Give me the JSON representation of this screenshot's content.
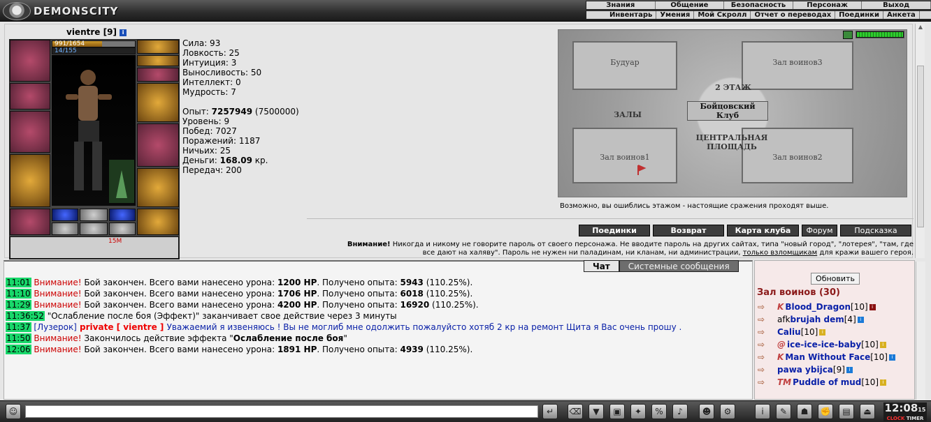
{
  "header": {
    "logo": "DEMONSCITY",
    "menu_top": [
      "Знания",
      "Общение",
      "Безопасность",
      "Персонаж",
      "Выход"
    ],
    "menu_sub": [
      "Инвентарь",
      "Умения",
      "Мой Скролл",
      "Отчет о переводах",
      "Поединки",
      "Анкета"
    ]
  },
  "character": {
    "name": "vientre",
    "level": "[9]",
    "hp": "991/1654",
    "mana": "14/155",
    "hp_fraction": 0.6,
    "item_badge": "15M"
  },
  "stats": {
    "strength": "Сила: 93",
    "agility": "Ловкость: 25",
    "intuition": "Интуиция: 3",
    "endurance": "Выносливость: 50",
    "intellect": "Интеллект: 0",
    "wisdom": "Мудрость: 7",
    "exp_label": "Опыт: ",
    "exp_value": "7257949",
    "exp_next": " (7500000)",
    "level": "Уровень: 9",
    "wins": "Побед: 7027",
    "losses": "Поражений: 1187",
    "draws": "Ничьих: 25",
    "money_label": "Деньги: ",
    "money_value": "168.09",
    "money_unit": " кр.",
    "transfers": "Передач: 200"
  },
  "map": {
    "rooms": [
      "Будуар",
      "Зал воинов3",
      "Зал воинов1",
      "Зал воинов2"
    ],
    "floor": "2 ЭТАЖ",
    "club": "Бойцовский Клуб",
    "halls": "ЗАЛЫ",
    "center": "ЦЕНТРАЛЬНАЯ ПЛОЩАДЬ",
    "tip": "Возможно, вы ошиблись этажом - настоящие сражения проходят выше."
  },
  "buttons": [
    "Поединки",
    "Возврат",
    "Карта клуба",
    "Форум",
    "Подсказка"
  ],
  "warning": {
    "bold": "Внимание!",
    "text1": " Никогда и никому не говорите пароль от своего персонажа. Не вводите пароль на других сайтах, типа \"новый город\", \"лотерея\", \"там, где",
    "text2": "все дают на халяву\". Пароль не нужен ни паладинам, ни кланам, ни администрации, ",
    "link": "только взломщикам",
    "text3": " для кражи вашего героя."
  },
  "chat": {
    "tabs": [
      "Чат",
      "Системные сообщения"
    ],
    "messages": [
      {
        "time": "11:01",
        "prefix": "Внимание!",
        "text": " Бой закончен. Всего вами нанесено урона: ",
        "b1": "1200 HP",
        "t2": ". Получено опыта: ",
        "b2": "5943",
        "t3": " (110.25%)."
      },
      {
        "time": "11:10",
        "prefix": "Внимание!",
        "text": " Бой закончен. Всего вами нанесено урона: ",
        "b1": "1706 HP",
        "t2": ". Получено опыта: ",
        "b2": "6018",
        "t3": " (110.25%)."
      },
      {
        "time": "11:29",
        "prefix": "Внимание!",
        "text": " Бой закончен. Всего вами нанесено урона: ",
        "b1": "4200 HP",
        "t2": ". Получено опыта: ",
        "b2": "16920",
        "t3": " (110.25%)."
      },
      {
        "time": "11:36:52",
        "prefix": "",
        "text": " \"Ослабление после боя (Эффект)\" заканчивает свое действие через 3 минуты",
        "b1": "",
        "t2": "",
        "b2": "",
        "t3": ""
      },
      {
        "time": "11:37",
        "private": true,
        "from": "[Лузерок]",
        "priv": " private [ vientre ] ",
        "body": "Уважаемий я извеняюсь ! Вы не моглиб мне одолжить пожалуйсто хотяб 2 кр на ремонт Щита я Вас очень прошу ."
      },
      {
        "time": "11:50",
        "prefix": "Внимание!",
        "text": " Закончилось действие эффекта \"",
        "b1": "Ослабление после боя",
        "t2": "\"",
        "b2": "",
        "t3": ""
      },
      {
        "time": "12:06",
        "prefix": "Внимание!",
        "text": " Бой закончен. Всего вами нанесено урона: ",
        "b1": "1891 HP",
        "t2": ". Получено опыта: ",
        "b2": "4939",
        "t3": " (110.25%)."
      }
    ]
  },
  "room": {
    "refresh": "Обновить",
    "title": "Зал воинов (30)",
    "users": [
      {
        "prefix": "",
        "clan": "K",
        "name": "Blood_Dragon",
        "lvl": "[10]",
        "badge": "#8a1010"
      },
      {
        "prefix": "afk ",
        "clan": "",
        "name": "brujah dem",
        "lvl": "[4]",
        "badge": "#1a7ad8"
      },
      {
        "prefix": "",
        "clan": "",
        "name": "Caliu",
        "lvl": "[10]",
        "badge": "#d8b020"
      },
      {
        "prefix": "",
        "clan": "@",
        "name": "ice-ice-ice-baby",
        "lvl": "[10]",
        "badge": "#d8b020"
      },
      {
        "prefix": "",
        "clan": "K",
        "name": "Man Without Face",
        "lvl": "[10]",
        "badge": "#1a7ad8"
      },
      {
        "prefix": "",
        "clan": "",
        "name": "pawa ybijca",
        "lvl": "[9]",
        "badge": "#1a7ad8"
      },
      {
        "prefix": "",
        "clan": "TM",
        "name": "Puddle of mud",
        "lvl": "[10]",
        "badge": "#d8b020"
      }
    ]
  },
  "clock": {
    "time": "12:08",
    "label1": "CLOCK",
    "label2": "TIMER",
    "sec": "15"
  },
  "colors": {
    "accent_red": "#c00000",
    "name_blue": "#0a21a8",
    "time_green": "#18d86a"
  }
}
